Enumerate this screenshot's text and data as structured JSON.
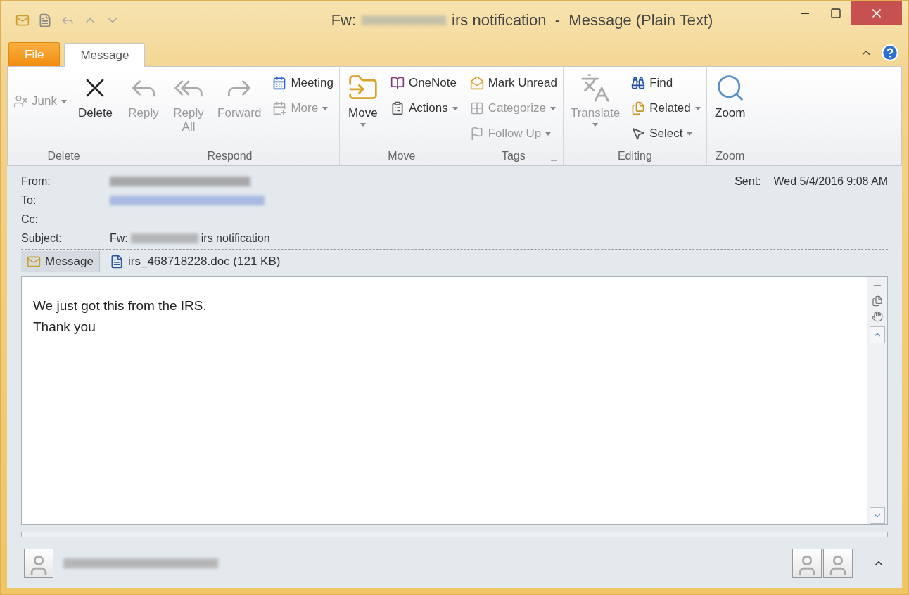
{
  "window": {
    "title_prefix": "Fw:",
    "title_suffix": "irs notification  -  Message (Plain Text)"
  },
  "tabs": [
    {
      "label": "File",
      "kind": "file",
      "selected": false
    },
    {
      "label": "Message",
      "kind": "tab",
      "selected": true
    }
  ],
  "ribbon": [
    {
      "label": "Delete",
      "launcher": false,
      "columns": [
        [
          {
            "label": "Junk",
            "kind": "small",
            "disabled": true,
            "dropdown": true
          }
        ],
        [
          {
            "label": "Delete",
            "kind": "large",
            "disabled": false,
            "dropdown": false
          }
        ]
      ]
    },
    {
      "label": "Respond",
      "launcher": false,
      "columns": [
        [
          {
            "label": "Reply",
            "kind": "large",
            "disabled": true,
            "dropdown": false
          }
        ],
        [
          {
            "label": "Reply All",
            "kind": "large",
            "disabled": true,
            "dropdown": false
          }
        ],
        [
          {
            "label": "Forward",
            "kind": "large",
            "disabled": true,
            "dropdown": false
          }
        ],
        [
          {
            "label": "Meeting",
            "kind": "small",
            "disabled": false,
            "dropdown": false
          },
          {
            "label": "More",
            "kind": "small",
            "disabled": true,
            "dropdown": true
          }
        ]
      ]
    },
    {
      "label": "Move",
      "launcher": false,
      "columns": [
        [
          {
            "label": "Move",
            "kind": "large",
            "disabled": false,
            "dropdown": true
          }
        ],
        [
          {
            "label": "OneNote",
            "kind": "small",
            "disabled": false,
            "dropdown": false
          },
          {
            "label": "Actions",
            "kind": "small",
            "disabled": false,
            "dropdown": true
          }
        ]
      ]
    },
    {
      "label": "Tags",
      "launcher": true,
      "columns": [
        [
          {
            "label": "Mark Unread",
            "kind": "small",
            "disabled": false,
            "dropdown": false
          },
          {
            "label": "Categorize",
            "kind": "small",
            "disabled": true,
            "dropdown": true
          },
          {
            "label": "Follow Up",
            "kind": "small",
            "disabled": true,
            "dropdown": true
          }
        ]
      ]
    },
    {
      "label": "Editing",
      "launcher": false,
      "columns": [
        [
          {
            "label": "Translate",
            "kind": "large",
            "disabled": true,
            "dropdown": true
          }
        ],
        [
          {
            "label": "Find",
            "kind": "small",
            "disabled": false,
            "dropdown": false
          },
          {
            "label": "Related",
            "kind": "small",
            "disabled": false,
            "dropdown": true
          },
          {
            "label": "Select",
            "kind": "small",
            "disabled": false,
            "dropdown": true
          }
        ]
      ]
    },
    {
      "label": "Zoom",
      "launcher": false,
      "columns": [
        [
          {
            "label": "Zoom",
            "kind": "large",
            "disabled": false,
            "dropdown": false
          }
        ]
      ]
    }
  ],
  "header": {
    "from_label": "From:",
    "to_label": "To:",
    "cc_label": "Cc:",
    "subject_label": "Subject:",
    "subject_prefix": "Fw:",
    "subject_suffix": "irs notification",
    "sent_label": "Sent:",
    "sent_value": "Wed 5/4/2016 9:08 AM"
  },
  "attachments": [
    {
      "label": "Message",
      "kind": "message",
      "selected": true
    },
    {
      "label": "irs_468718228.doc (121 KB)",
      "kind": "file",
      "selected": false
    }
  ],
  "body": [
    "We just got this from the IRS.",
    "Thank you"
  ]
}
